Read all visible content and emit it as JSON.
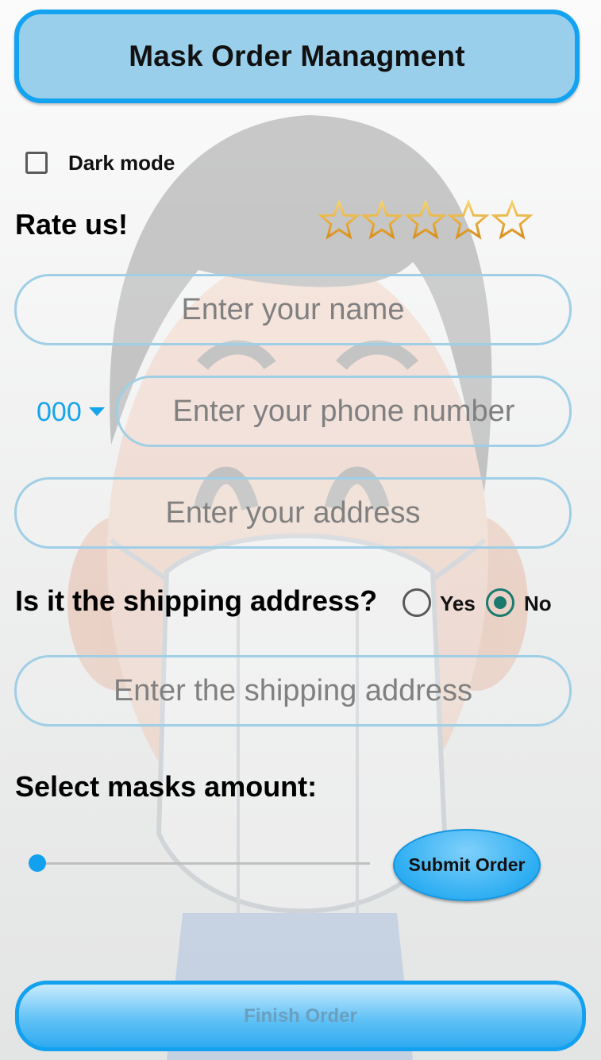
{
  "header": {
    "title": "Mask Order Managment"
  },
  "dark_mode": {
    "label": "Dark mode",
    "checked": false
  },
  "rating": {
    "label": "Rate us!",
    "stars_total": 5,
    "stars_filled": 0
  },
  "form": {
    "name_placeholder": "Enter your name",
    "phone_code": "000",
    "phone_placeholder": "Enter your phone number",
    "address_placeholder": "Enter your address",
    "shipping_question": "Is it the shipping address?",
    "yes_label": "Yes",
    "no_label": "No",
    "selected_option": "No",
    "shipping_placeholder": "Enter the shipping address"
  },
  "masks": {
    "label": "Select masks amount:",
    "slider_fraction": 0
  },
  "buttons": {
    "submit": "Submit Order",
    "finish": "Finish Order"
  },
  "colors": {
    "accent": "#14a3f0",
    "header_bg": "#99cfeb",
    "radio_selected": "#1a7a6e"
  }
}
